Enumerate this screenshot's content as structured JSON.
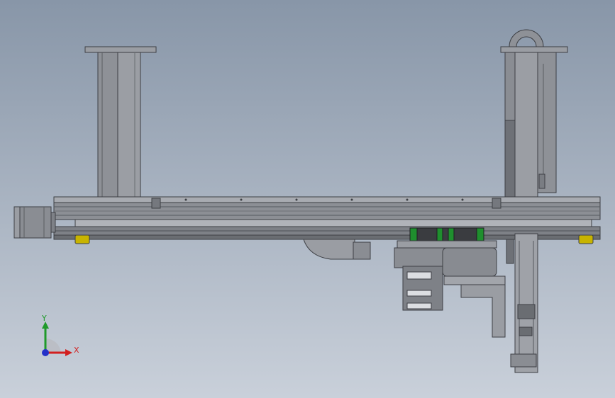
{
  "view": {
    "background_top": "#8896a8",
    "background_bottom": "#c9d0da"
  },
  "colors": {
    "frame_gray": "#8c8f95",
    "frame_dark": "#55585e",
    "frame_light": "#b9bcc2",
    "linear_guide_green": "#1f8f2e",
    "foot_pad_yellow": "#c8b400",
    "axis_x": "#d21f1f",
    "axis_y": "#1f9a2a",
    "axis_origin": "#2430c8"
  },
  "triad": {
    "x_label": "X",
    "y_label": "Y"
  }
}
